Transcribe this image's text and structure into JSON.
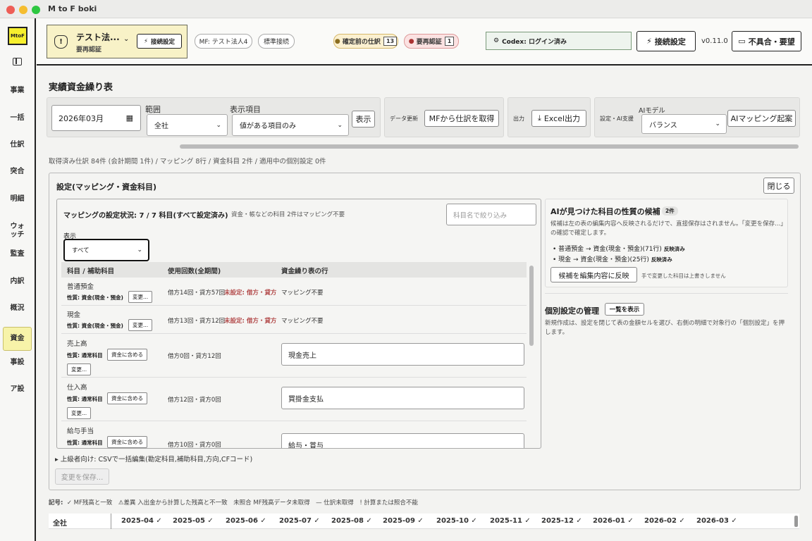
{
  "window": {
    "title": "M to F boki"
  },
  "sidebar": {
    "logo": "MtoF",
    "items": [
      {
        "label": "事業"
      },
      {
        "label": "一括"
      },
      {
        "label": "仕訳"
      },
      {
        "label": "突合"
      },
      {
        "label": "明細"
      },
      {
        "label": "ウォッチ"
      },
      {
        "label": "監査"
      },
      {
        "label": "内訳"
      },
      {
        "label": "概況"
      },
      {
        "label": "資金"
      },
      {
        "label": "事設"
      },
      {
        "label": "ア設"
      }
    ]
  },
  "header": {
    "company_name": "テスト法...",
    "company_status": "要再認証",
    "company_icon": "!",
    "connect_small": "接続設定",
    "mf_label": "MF: テスト法人4",
    "std_label": "標準接続",
    "pending_label": "確定前の仕訳",
    "pending_count": "13",
    "reauth_label": "要再認証",
    "reauth_count": "1",
    "codex_label": "Codex: ログイン済み",
    "connect_label": "接続設定",
    "version": "v0.11.0",
    "feedback_label": "不具合・要望"
  },
  "page": {
    "title": "実績資金繰り表"
  },
  "filters": {
    "month_value": "2026年03月",
    "range_label": "範囲",
    "range_value": "全社",
    "display_label": "表示項目",
    "display_value": "値がある項目のみ",
    "show_button": "表示",
    "data_update_label": "データ更新",
    "fetch_button": "MFから仕訳を取得",
    "output_label": "出力",
    "excel_button": "Excel出力",
    "ai_label": "設定・AI支援",
    "ai_model_label": "AIモデル",
    "ai_model_value": "バランス",
    "ai_mapping_button": "AIマッピング起案"
  },
  "summary": "取得済み仕訳 84件 (会計期間 1件) / マッピング 8行 / 資金科目 2件 / 適用中の個別設定 0件",
  "settings": {
    "title": "設定(マッピング・資金科目)",
    "close_button": "閉じる",
    "mapping_status": "マッピングの設定状況: 7 / 7 科目(すべて設定済み)",
    "mapping_note": "資金・帳などの科目 2件はマッピング不要",
    "filter_placeholder": "科目名で絞り込み",
    "display_label": "表示",
    "display_value": "すべて",
    "columns": [
      "科目 / 補助科目",
      "使用回数(全期間)",
      "資金繰り表の行"
    ],
    "rows": [
      {
        "name": "普通預金",
        "prop": "性質: 資金(現金・預金)",
        "action": "変更...",
        "usage": "借方14回・貸方57回",
        "unset": "未設定: 借方・貸方",
        "mapping": "マッピング不要"
      },
      {
        "name": "現金",
        "prop": "性質: 資金(現金・預金)",
        "action": "変更...",
        "usage": "借方13回・貸方12回",
        "unset": "未設定: 借方・貸方",
        "mapping": "マッピング不要"
      },
      {
        "name": "売上高",
        "prop": "性質: 通常科目",
        "include": "資金に含める",
        "action": "変更...",
        "usage": "借方0回・貸方12回",
        "mapping": "現金売上"
      },
      {
        "name": "仕入高",
        "prop": "性質: 通常科目",
        "include": "資金に含める",
        "action": "変更...",
        "usage": "借方12回・貸方0回",
        "mapping": "買掛金支払"
      },
      {
        "name": "給与手当",
        "prop": "性質: 通常科目",
        "include": "資金に含める",
        "usage": "借方10回・貸方0回",
        "mapping": "給与・賞与"
      }
    ],
    "advanced": "▸ 上級者向け: CSVで一括編集(勘定科目,補助科目,方向,CFコード)",
    "save_button": "変更を保存..."
  },
  "ai": {
    "title": "AIが見つけた科目の性質の候補",
    "count": "2件",
    "desc": "候補は左の表の編集内容へ反映されるだけで、直接保存はされません。「変更を保存...」の確認で確定します。",
    "items": [
      {
        "text": "普通預金 → 資金(現金・預金)(71行)",
        "status": "反映済み"
      },
      {
        "text": "現金 → 資金(現金・預金)(25行)",
        "status": "反映済み"
      }
    ],
    "apply_button": "候補を編集内容に反映",
    "apply_note": "手で変更した科目は上書きしません"
  },
  "individual": {
    "title": "個別設定の管理",
    "list_button": "一覧を表示",
    "desc": "新規作成は、設定を閉じて表の金額セルを選び、右側の明細で対象行の「個別設定」を押します。"
  },
  "legend": {
    "label": "記号:",
    "text": "✓ MF残高と一致　⚠差異 入出金から計算した残高と不一致　未照合 MF残高データ未取得　— 仕訳未取得　! 計算または照合不能"
  },
  "table": {
    "first_col": "全社",
    "months": [
      "2025-04 ✓",
      "2025-05 ✓",
      "2025-06 ✓",
      "2025-07 ✓",
      "2025-08 ✓",
      "2025-09 ✓",
      "2025-10 ✓",
      "2025-11 ✓",
      "2025-12 ✓",
      "2026-01 ✓",
      "2026-02 ✓",
      "2026-03 ✓"
    ]
  },
  "colors": {
    "accent_yellow": "#f6ef2e",
    "sidebar_active": "#f7f3a9",
    "warn_red": "#b34a4a"
  }
}
